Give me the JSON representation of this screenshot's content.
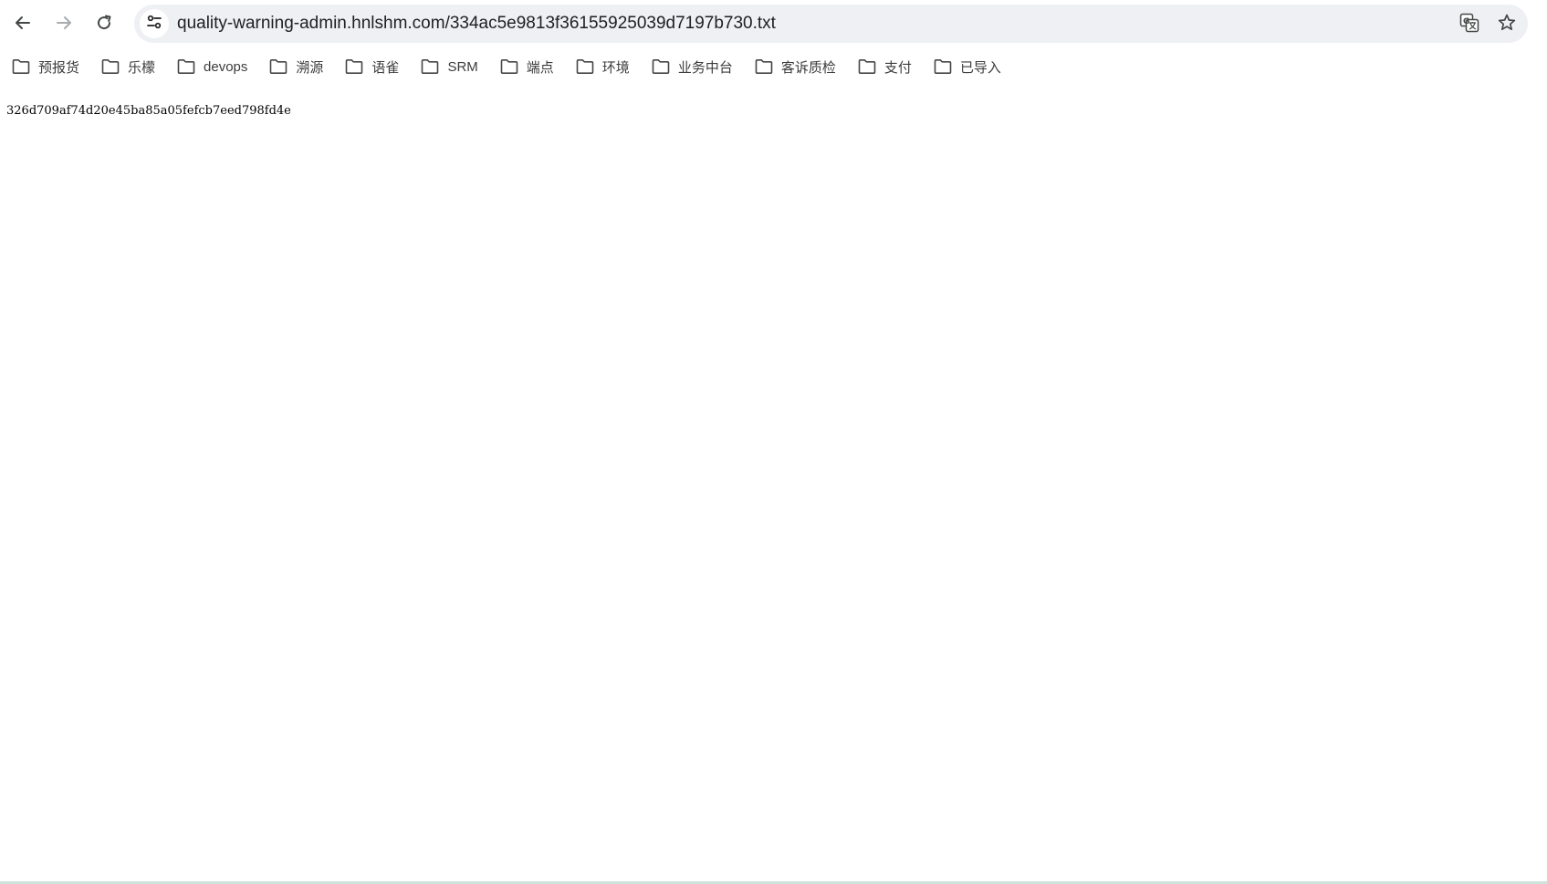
{
  "browser": {
    "url": "quality-warning-admin.hnlshm.com/334ac5e9813f36155925039d7197b730.txt",
    "icons": {
      "back": "arrow-left-icon",
      "forward": "arrow-right-icon",
      "reload": "reload-icon",
      "site_info": "tune-icon",
      "translate": "translate-icon",
      "bookmark_star": "star-icon"
    }
  },
  "bookmarks_bar": {
    "items": [
      {
        "label": "预报货"
      },
      {
        "label": "乐檬"
      },
      {
        "label": "devops"
      },
      {
        "label": "溯源"
      },
      {
        "label": "语雀"
      },
      {
        "label": "SRM"
      },
      {
        "label": "端点"
      },
      {
        "label": "环境"
      },
      {
        "label": "业务中台"
      },
      {
        "label": "客诉质检"
      },
      {
        "label": "支付"
      },
      {
        "label": "已导入"
      }
    ]
  },
  "page": {
    "content": "326d709af74d20e45ba85a05fefcb7eed798fd4e"
  },
  "colors": {
    "omnibox_bg": "#eef0f4",
    "text": "#1f1f1f",
    "bookmark_text": "#3c3c3c",
    "page_bg": "#ffffff"
  }
}
